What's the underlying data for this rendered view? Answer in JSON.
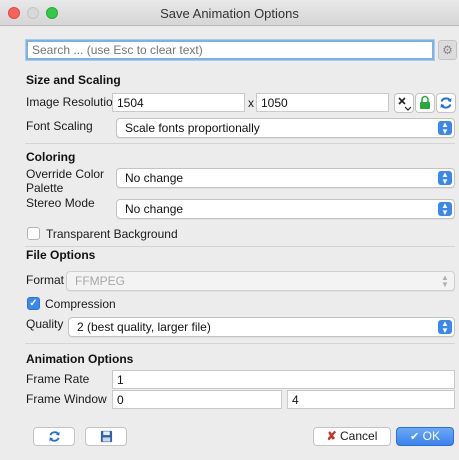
{
  "window": {
    "title": "Save Animation Options"
  },
  "search": {
    "placeholder": "Search ... (use Esc to clear text)",
    "value": ""
  },
  "size_scaling": {
    "heading": "Size and Scaling",
    "resolution_label": "Image Resolution",
    "width": "1504",
    "separator": "x",
    "height": "1050",
    "font_scaling_label": "Font Scaling",
    "font_scaling_value": "Scale fonts proportionally"
  },
  "coloring": {
    "heading": "Coloring",
    "override_label_line1": "Override Color",
    "override_label_line2": "Palette",
    "override_value": "No change",
    "stereo_label": "Stereo Mode",
    "stereo_value": "No change",
    "transparent_label": "Transparent Background",
    "transparent_checked": false
  },
  "file_options": {
    "heading": "File Options",
    "format_label": "Format",
    "format_value": "FFMPEG",
    "compression_label": "Compression",
    "compression_checked": true,
    "quality_label": "Quality",
    "quality_value": "2 (best quality, larger file)"
  },
  "animation": {
    "heading": "Animation Options",
    "frame_rate_label": "Frame Rate",
    "frame_rate_value": "1",
    "frame_window_label": "Frame Window",
    "frame_window_start": "0",
    "frame_window_end": "4"
  },
  "footer": {
    "cancel_label": "Cancel",
    "ok_label": "OK"
  },
  "colors": {
    "accent": "#3b87f0",
    "close": "#fc605c",
    "zoom": "#34c84a",
    "lock": "#2aa83a",
    "cancel_icon": "#c0392b"
  }
}
